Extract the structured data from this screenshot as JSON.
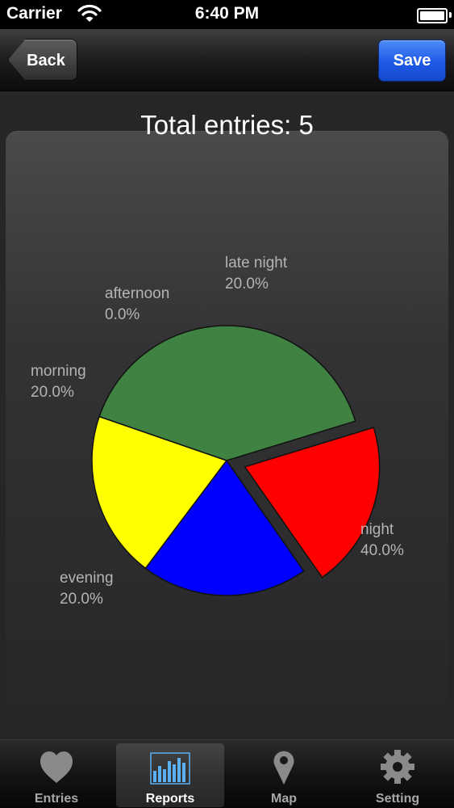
{
  "status_bar": {
    "carrier": "Carrier",
    "time": "6:40 PM"
  },
  "nav": {
    "back_label": "Back",
    "save_label": "Save"
  },
  "header": {
    "title": "Total entries: 5"
  },
  "chart_data": {
    "type": "pie",
    "title": "Total entries: 5",
    "slices": [
      {
        "label": "late night",
        "percent_label": "20.0%",
        "value": 20.0,
        "color": "#ff0000",
        "exploded": true
      },
      {
        "label": "night",
        "percent_label": "40.0%",
        "value": 40.0,
        "color": "#3f8242",
        "exploded": false
      },
      {
        "label": "evening",
        "percent_label": "20.0%",
        "value": 20.0,
        "color": "#ffff00",
        "exploded": false
      },
      {
        "label": "morning",
        "percent_label": "20.0%",
        "value": 20.0,
        "color": "#0000ff",
        "exploded": false
      },
      {
        "label": "afternoon",
        "percent_label": "0.0%",
        "value": 0.0,
        "color": "#ff8c00",
        "exploded": false
      }
    ]
  },
  "tabs": [
    {
      "label": "Entries",
      "icon": "heart-icon",
      "active": false
    },
    {
      "label": "Reports",
      "icon": "bar-chart-icon",
      "active": true
    },
    {
      "label": "Map",
      "icon": "map-pin-icon",
      "active": false
    },
    {
      "label": "Setting",
      "icon": "gear-icon",
      "active": false
    }
  ],
  "colors": {
    "save_button": "#2a64ea",
    "active_tab_icon": "#5ab0f0"
  }
}
